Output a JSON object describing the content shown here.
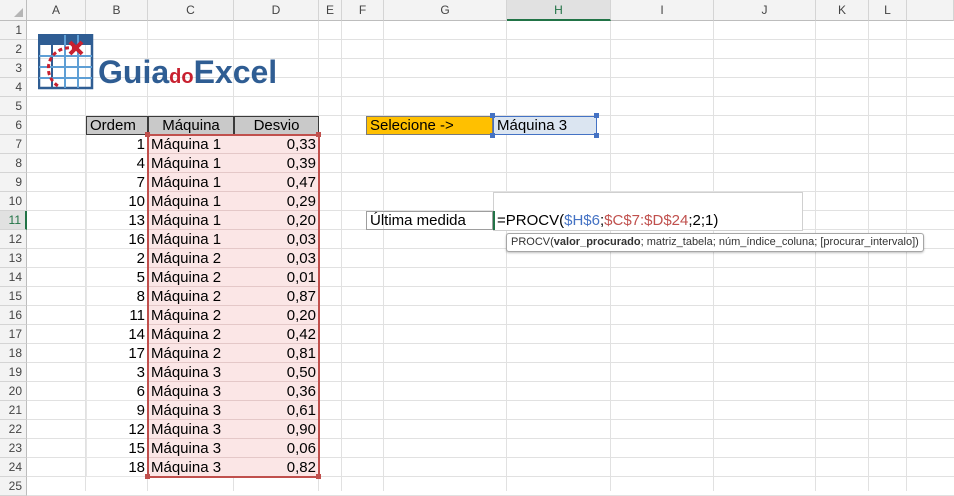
{
  "columns": [
    "A",
    "B",
    "C",
    "D",
    "E",
    "F",
    "G",
    "H",
    "I",
    "J",
    "K",
    "L"
  ],
  "active_column": "H",
  "rows": [
    "1",
    "2",
    "3",
    "4",
    "5",
    "6",
    "7",
    "8",
    "9",
    "10",
    "11",
    "12",
    "13",
    "14",
    "15",
    "16",
    "17",
    "18",
    "19",
    "20",
    "21",
    "22",
    "23",
    "24",
    "25"
  ],
  "active_row": "11",
  "logo": {
    "text_guia": "Guia",
    "text_do": "do",
    "text_excel": "Excel",
    "colors": {
      "blue": "#2f5d93",
      "red": "#c8202f",
      "lightblue": "#5f9fd5"
    }
  },
  "table": {
    "headers": [
      "Ordem",
      "Máquina",
      "Desvio"
    ],
    "rows": [
      [
        "1",
        "Máquina 1",
        "0,33"
      ],
      [
        "4",
        "Máquina 1",
        "0,39"
      ],
      [
        "7",
        "Máquina 1",
        "0,47"
      ],
      [
        "10",
        "Máquina 1",
        "0,29"
      ],
      [
        "13",
        "Máquina 1",
        "0,20"
      ],
      [
        "16",
        "Máquina 1",
        "0,03"
      ],
      [
        "2",
        "Máquina 2",
        "0,03"
      ],
      [
        "5",
        "Máquina 2",
        "0,01"
      ],
      [
        "8",
        "Máquina 2",
        "0,87"
      ],
      [
        "11",
        "Máquina 2",
        "0,20"
      ],
      [
        "14",
        "Máquina 2",
        "0,42"
      ],
      [
        "17",
        "Máquina 2",
        "0,81"
      ],
      [
        "3",
        "Máquina 3",
        "0,50"
      ],
      [
        "6",
        "Máquina 3",
        "0,36"
      ],
      [
        "9",
        "Máquina 3",
        "0,61"
      ],
      [
        "12",
        "Máquina 3",
        "0,90"
      ],
      [
        "15",
        "Máquina 3",
        "0,06"
      ],
      [
        "18",
        "Máquina 3",
        "0,82"
      ]
    ]
  },
  "selector": {
    "label": "Selecione ->",
    "value": "Máquina 3",
    "label_color": "#ffc000"
  },
  "formula_row": {
    "label": "Última medida",
    "f_prefix": "=PROCV(",
    "f_ref1": "$H$6",
    "f_sep1": ";",
    "f_ref2": "$C$7:$D$24",
    "f_suffix": ";2;1)",
    "ref1_color": "#4472c4",
    "ref2_color": "#c0504d"
  },
  "tooltip": {
    "fn": "PROCV(",
    "arg1": "valor_procurado",
    "rest": "; matriz_tabela; núm_índice_coluna; [procurar_intervalo])"
  }
}
